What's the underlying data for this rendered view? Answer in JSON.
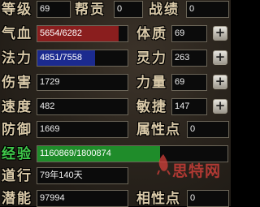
{
  "stats": {
    "level_label": "等级",
    "level_value": "69",
    "contribution_label": "帮贡",
    "contribution_value": "0",
    "battle_label": "战绩",
    "battle_value": "0",
    "hp_label": "气血",
    "hp_value": "5654/6282",
    "hp_fraction": 0.9,
    "constitution_label": "体质",
    "constitution_value": "69",
    "mp_label": "法力",
    "mp_value": "4851/7558",
    "mp_fraction": 0.642,
    "spirit_label": "灵力",
    "spirit_value": "263",
    "damage_label": "伤害",
    "damage_value": "1729",
    "strength_label": "力量",
    "strength_value": "69",
    "speed_label": "速度",
    "speed_value": "482",
    "agility_label": "敏捷",
    "agility_value": "147",
    "defense_label": "防御",
    "defense_value": "1669",
    "attr_points_label": "属性点",
    "attr_points_value": "0",
    "exp_label": "经验",
    "exp_value": "1160869/1800874",
    "exp_fraction": 0.645,
    "cultivation_label": "道行",
    "cultivation_value": "79年140天",
    "potential_label": "潜能",
    "potential_value": "97994",
    "affinity_points_label": "相性点",
    "affinity_points_value": "0"
  },
  "buttons": {
    "plus_symbol": "+"
  },
  "watermark": {
    "text": "思特网"
  },
  "colors": {
    "hp_fill": "#8a1e1e",
    "mp_fill": "#1b2a8f",
    "exp_fill": "#1f8c2a",
    "label_color": "#d9c9a8",
    "exp_label_color": "#3fc84a"
  },
  "icons": {
    "plus": "plus-icon"
  }
}
